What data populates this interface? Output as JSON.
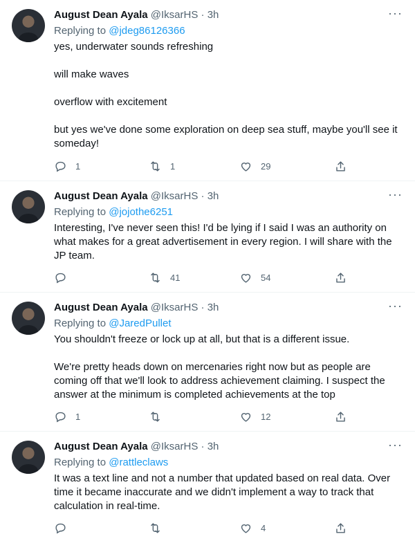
{
  "tweets": [
    {
      "name": "August Dean Ayala",
      "handle": "@IksarHS",
      "dot": "·",
      "time": "3h",
      "replying_prefix": "Replying to ",
      "replying_to": "@jdeg86126366",
      "paragraphs": [
        "yes, underwater sounds refreshing",
        "will make waves",
        "overflow with excitement",
        "but yes we've done some exploration on deep sea stuff, maybe you'll see it someday!"
      ],
      "reply_count": "1",
      "retweet_count": "1",
      "like_count": "29",
      "share_count": ""
    },
    {
      "name": "August Dean Ayala",
      "handle": "@IksarHS",
      "dot": "·",
      "time": "3h",
      "replying_prefix": "Replying to ",
      "replying_to": "@jojothe6251",
      "paragraphs": [
        "Interesting, I've never seen this! I'd be lying if I said I was an authority on what makes for a great advertisement in every region. I will share with the JP team."
      ],
      "reply_count": "",
      "retweet_count": "41",
      "like_count": "54",
      "share_count": ""
    },
    {
      "name": "August Dean Ayala",
      "handle": "@IksarHS",
      "dot": "·",
      "time": "3h",
      "replying_prefix": "Replying to ",
      "replying_to": "@JaredPullet",
      "paragraphs": [
        "You shouldn't freeze or lock up at all, but that is a different issue.",
        "We're pretty heads down on mercenaries right now but as people are coming off that we'll look to address achievement claiming. I suspect the answer at the minimum is completed achievements at the top"
      ],
      "reply_count": "1",
      "retweet_count": "",
      "like_count": "12",
      "share_count": ""
    },
    {
      "name": "August Dean Ayala",
      "handle": "@IksarHS",
      "dot": "·",
      "time": "3h",
      "replying_prefix": "Replying to ",
      "replying_to": "@rattleclaws",
      "paragraphs": [
        "It was a text line and not a number that updated based on real data. Over time it became inaccurate and we didn't implement a way to track that calculation in real-time."
      ],
      "reply_count": "",
      "retweet_count": "",
      "like_count": "4",
      "share_count": ""
    }
  ],
  "more_glyph": "···",
  "colors": {
    "text": "#0f1419",
    "muted": "#536471",
    "link": "#1d9bf0",
    "divider": "#eff3f4"
  },
  "icons": [
    "reply-icon",
    "retweet-icon",
    "like-icon",
    "share-icon",
    "more-icon"
  ]
}
